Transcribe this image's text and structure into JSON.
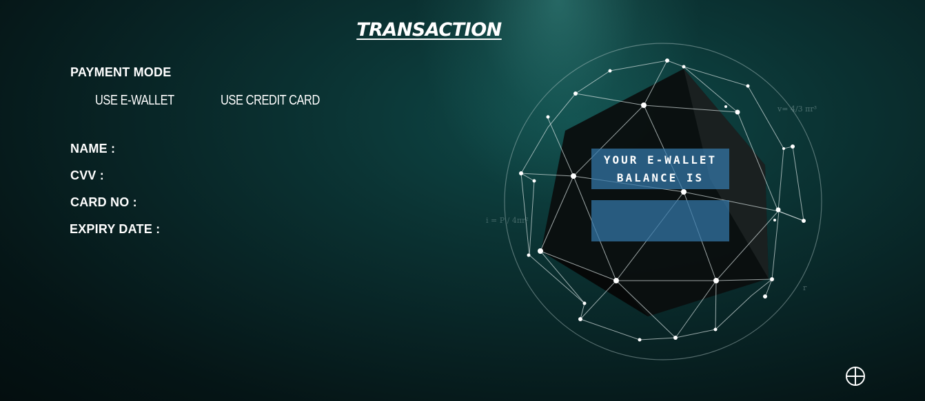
{
  "header": {
    "title": "TRANSACTION"
  },
  "payment": {
    "mode_label": "PAYMENT MODE",
    "options": [
      "USE E-WALLET",
      "USE CREDIT CARD"
    ]
  },
  "form": {
    "name_label": "NAME :",
    "cvv_label": "CVV :",
    "card_no_label": "CARD NO :",
    "expiry_label": "EXPIRY DATE :"
  },
  "wallet": {
    "balance_label_line1": "YOUR E-WALLET",
    "balance_label_line2": "BALANCE IS",
    "balance_value": ""
  },
  "globe_formulas": {
    "volume": "v= 4/3 πr³",
    "inertia": "i = P / 4πr²",
    "radius": "r"
  },
  "controls": {
    "fullscreen_icon": "fullscreen-icon"
  },
  "colors": {
    "background": "#082425",
    "panel": "#3478aa",
    "text": "#ffffff"
  }
}
